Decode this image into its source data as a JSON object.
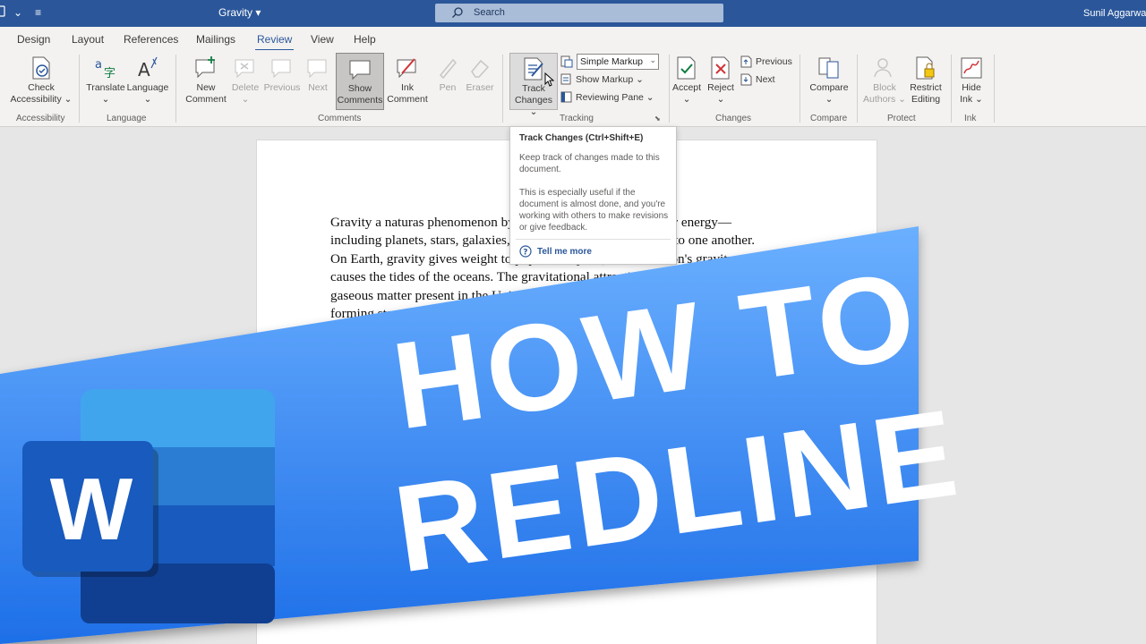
{
  "titlebar": {
    "qat_icon": "autosave-icon",
    "qat_chevron": "⌄",
    "qat_customize": "≡",
    "doc_title": "Gravity",
    "doc_title_chevron": "▾",
    "search_placeholder": "Search",
    "user_name": "Sunil Aggarwal"
  },
  "tabs": [
    "Design",
    "Layout",
    "References",
    "Mailings",
    "Review",
    "View",
    "Help"
  ],
  "active_tab": "Review",
  "ribbon": {
    "groups": {
      "accessibility": "Accessibility",
      "language": "Language",
      "comments": "Comments",
      "tracking": "Tracking",
      "changes": "Changes",
      "compare": "Compare",
      "protect": "Protect",
      "ink": "Ink"
    },
    "check_accessibility": [
      "Check",
      "Accessibility ⌄"
    ],
    "translate": [
      "Translate",
      "⌄"
    ],
    "language": [
      "Language",
      "⌄"
    ],
    "new_comment": [
      "New",
      "Comment"
    ],
    "delete": [
      "Delete",
      "⌄"
    ],
    "previous_comment": "Previous",
    "next_comment": "Next",
    "show_comments": [
      "Show",
      "Comments"
    ],
    "ink_comment": [
      "Ink",
      "Comment"
    ],
    "pen": "Pen",
    "eraser": "Eraser",
    "track_changes": [
      "Track",
      "Changes ⌄"
    ],
    "simple_markup": "Simple Markup",
    "show_markup": "Show Markup ⌄",
    "reviewing_pane": "Reviewing Pane ⌄",
    "accept": [
      "Accept",
      "⌄"
    ],
    "reject": [
      "Reject",
      "⌄"
    ],
    "previous_change": "Previous",
    "next_change": "Next",
    "compare": [
      "Compare",
      "⌄"
    ],
    "block_authors": [
      "Block",
      "Authors ⌄"
    ],
    "restrict_editing": [
      "Restrict",
      "Editing"
    ],
    "hide_ink": [
      "Hide",
      "Ink ⌄"
    ]
  },
  "tooltip": {
    "title": "Track Changes (Ctrl+Shift+E)",
    "p1": "Keep track of changes made to this document.",
    "p2": "This is especially useful if the document is almost done, and you're working with others to make revisions or give feedback.",
    "more": "Tell me more"
  },
  "document": {
    "lines": [
      "Gravity a naturas phenomenon by which all things with mass or energy—",
      "including planets, stars, galaxies, and even light—are attracted to one another.",
      "On Earth, gravity gives weight to physical objects, and the Moon's gravity",
      "causes the tides of the oceans. The gravitational attraction of the original",
      "gaseous matter present in the Universe caused it to begin coalescing and",
      "forming stars"
    ]
  },
  "banner": {
    "line1": "HOW TO",
    "line2": "REDLINE",
    "color_light": "#6bb0ff",
    "color_dark": "#1e6fe8"
  },
  "logo": {
    "letter": "W",
    "colors": [
      "#41a5ee",
      "#2b7cd3",
      "#185abd",
      "#103f91"
    ]
  },
  "colors": {
    "titlebar": "#2b579a",
    "accent": "#2b579a"
  }
}
